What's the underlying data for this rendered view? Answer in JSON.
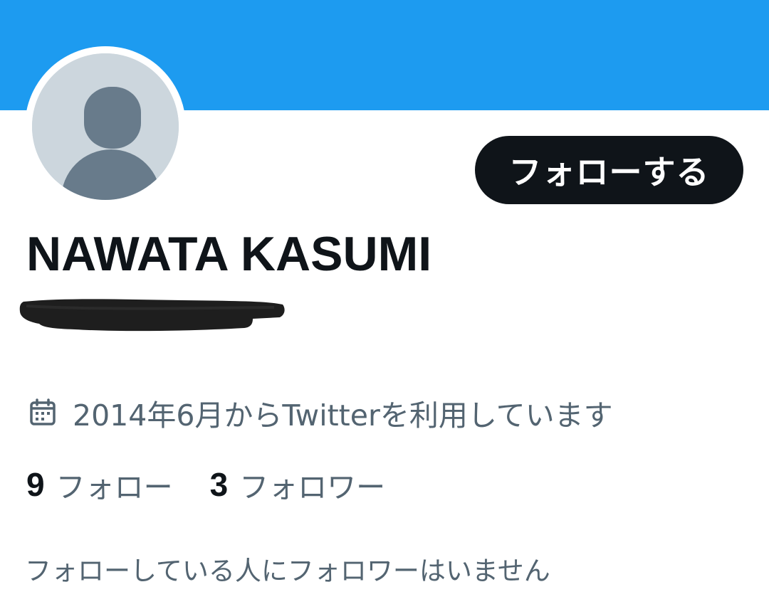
{
  "profile": {
    "display_name": "NAWATA KASUMI",
    "follow_button_label": "フォローする",
    "joined_text": "2014年6月からTwitterを利用しています",
    "mutual_followers_text": "フォローしている人にフォロワーはいません"
  },
  "stats": {
    "following_count": "9",
    "following_label": "フォロー",
    "followers_count": "3",
    "followers_label": "フォロワー"
  },
  "colors": {
    "banner": "#1d9bf0",
    "button_background": "#0f1419",
    "primary_text": "#0f1419",
    "secondary_text": "#536471",
    "avatar_placeholder_bg": "#ccd6dd",
    "avatar_placeholder_figure": "#687b8b"
  },
  "icons": {
    "joined_date": "calendar-icon",
    "avatar": "default-profile-icon"
  }
}
